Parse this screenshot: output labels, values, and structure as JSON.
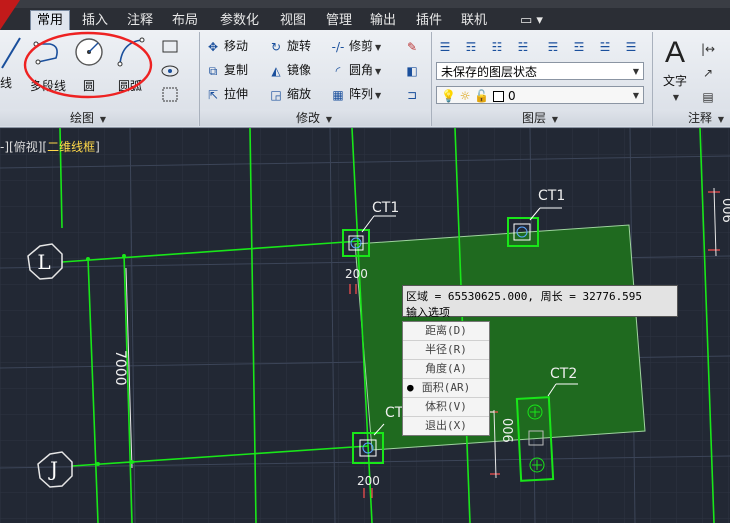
{
  "menu_tabs": [
    "常用",
    "插入",
    "注释",
    "布局",
    "参数化",
    "视图",
    "管理",
    "输出",
    "插件",
    "联机"
  ],
  "menu_extra": "▭ ▾",
  "draw_panel": {
    "title": "绘图",
    "buttons": [
      "直线",
      "多段线",
      "圆",
      "圆弧"
    ]
  },
  "modify_panel": {
    "title": "修改",
    "buttons": [
      "移动",
      "旋转",
      "修剪",
      "复制",
      "镜像",
      "圆角",
      "拉伸",
      "缩放",
      "阵列"
    ]
  },
  "layer_panel": {
    "title": "图层",
    "state_combo": "未保存的图层状态",
    "layer_combo": "0"
  },
  "annotation_panel": {
    "title": "注释",
    "text_button": "文字"
  },
  "viewport_label": {
    "prefix": "-][",
    "view": "俯视",
    "mid": "][",
    "style": "二维线框",
    "suffix": "]"
  },
  "tooltip": {
    "line1": "区域 = 65530625.000, 周长 = 32776.595",
    "line2": "输入选项"
  },
  "context_menu": {
    "items": [
      "距离(D)",
      "半径(R)",
      "角度(A)",
      "面积(AR)",
      "体积(V)",
      "退出(X)"
    ],
    "selected_index": 3
  },
  "drawing_labels": {
    "grid_L": "L",
    "grid_J": "J",
    "dim_7000": "7000",
    "dim_200_top": "200",
    "dim_200_bottom": "200",
    "dim_900_right": "006",
    "dim_900_ct2": "006",
    "ct1_a": "CT1",
    "ct1_b": "CT1",
    "ct1_c": "CT",
    "ct2": "CT2"
  },
  "colors": {
    "background": "#222834",
    "green_line": "#19e619",
    "hatch": "#1f6a1f",
    "dim_red": "#ff5050",
    "viewport_yellow": "#ffd84a"
  }
}
